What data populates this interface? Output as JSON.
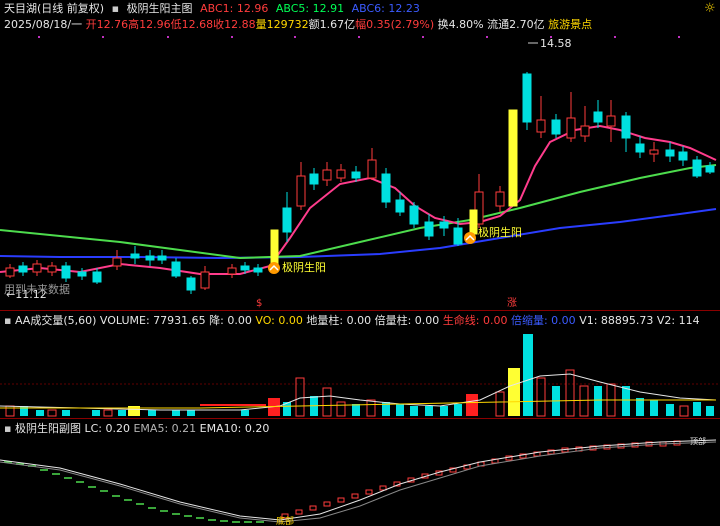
{
  "main": {
    "title": "天目湖(日线 前复权)",
    "indicator": "极阴生阳主图",
    "abc1": "ABC1: 12.96",
    "abc5": "ABC5: 12.91",
    "abc6": "ABC6: 12.23",
    "quote": {
      "date": "2025/08/18/一",
      "open": "开12.76",
      "high": "高12.96",
      "low": "低12.68",
      "close": "收12.88",
      "volume": "量129732",
      "amount": "额1.67亿",
      "change": "幅0.35(2.79%)",
      "turnover": "换4.80%",
      "float": "流通2.70亿",
      "sector": "旅游景点"
    },
    "high_label": "14.58",
    "low_label": "11.12",
    "signal_label": "极阴生阳",
    "no_future": "用到未来数据",
    "marker_s": "$",
    "marker_zhang": "涨"
  },
  "volume_panel": {
    "title": "AA成交量(5,60)",
    "volume": "VOLUME: 77931.65",
    "jiang": "降: 0.00",
    "vo": "VO: 0.00",
    "diliang": "地量柱: 0.00",
    "beiliang": "倍量柱: 0.00",
    "shengming": "生命线: 0.00",
    "beisuo": "倍缩量: 0.00",
    "v1": "V1: 88895.73",
    "v2": "V2: 114"
  },
  "sub_panel": {
    "title": "极阴生阳副图",
    "lc": "LC: 0.20",
    "ema5": "EMA5: 0.21",
    "ema10": "EMA10: 0.20",
    "bottom_label": "底部",
    "right_label": "顶部"
  },
  "colors": {
    "up": "#ff3c3c",
    "down": "#00e0e0",
    "ma_pink": "#ff3c8c",
    "ma_green": "#4ddc4d",
    "ma_blue": "#2a3dff",
    "signal": "#ffff33"
  }
}
